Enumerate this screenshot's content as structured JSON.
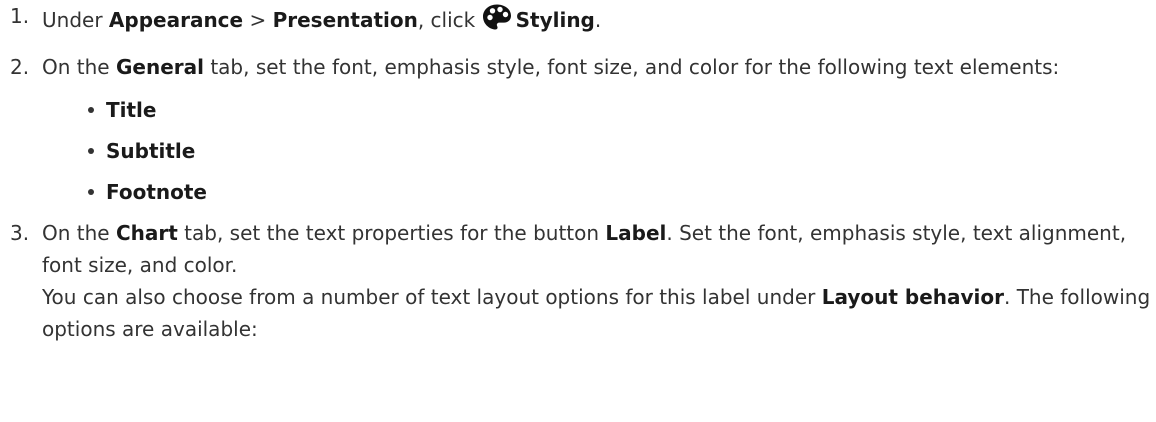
{
  "steps": [
    {
      "num": "1.",
      "t1": "Under ",
      "b1": "Appearance",
      "t2": " > ",
      "b2": "Presentation",
      "t3": ", click ",
      "icon": "palette-icon",
      "b3": "Styling",
      "t4": "."
    },
    {
      "num": "2.",
      "t1": "On the ",
      "b1": "General",
      "t2": " tab, set the font, emphasis style, font size, and color for the following text elements:",
      "bullets": [
        "Title",
        "Subtitle",
        "Footnote"
      ]
    },
    {
      "num": "3.",
      "t1": "On the ",
      "b1": "Chart",
      "t2": " tab, set the text properties for the button ",
      "b2": "Label",
      "t3": ". Set the font, emphasis style, text alignment, font size, and color.",
      "p2_t1": "You can also choose from a number of text layout options for this label under ",
      "p2_b1": "Layout behavior",
      "p2_t2": ". The following options are available:"
    }
  ]
}
